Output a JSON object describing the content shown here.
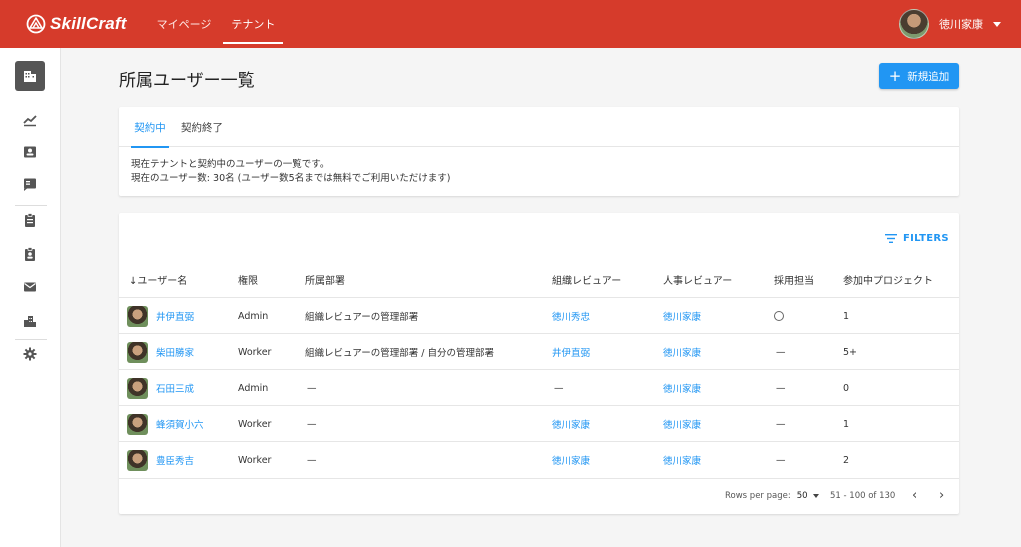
{
  "app": {
    "logo_text": "SkillCraft"
  },
  "nav": [
    {
      "label": "マイページ"
    },
    {
      "label": "テナント"
    }
  ],
  "user": {
    "name": "徳川家康"
  },
  "page": {
    "title": "所属ユーザー一覧",
    "add_button": "新規追加"
  },
  "tabs": [
    {
      "label": "契約中"
    },
    {
      "label": "契約終了"
    }
  ],
  "description": {
    "line1": "現在テナントと契約中のユーザーの一覧です。",
    "line2": "現在のユーザー数: 30名 (ユーザー数5名までは無料でご利用いただけます)"
  },
  "filters_label": "FILTERS",
  "columns": {
    "name": "ユーザー名",
    "role": "権限",
    "dept": "所属部署",
    "org_reviewer": "組織レビュアー",
    "hr_reviewer": "人事レビュアー",
    "recruiting": "採用担当",
    "projects": "参加中プロジェクト"
  },
  "rows": [
    {
      "name": "井伊直弼",
      "role": "Admin",
      "dept": "組織レビュアーの管理部署",
      "org_reviewer": "徳川秀忠",
      "hr_reviewer": "徳川家康",
      "recruiting": "",
      "projects": "1"
    },
    {
      "name": "柴田勝家",
      "role": "Worker",
      "dept": "組織レビュアーの管理部署 / 自分の管理部署",
      "org_reviewer": "井伊直弼",
      "hr_reviewer": "徳川家康",
      "recruiting": "—",
      "projects": "5+"
    },
    {
      "name": "石田三成",
      "role": "Admin",
      "dept": "—",
      "org_reviewer": "—",
      "hr_reviewer": "徳川家康",
      "recruiting": "—",
      "projects": "0"
    },
    {
      "name": "蜂須賀小六",
      "role": "Worker",
      "dept": "—",
      "org_reviewer": "徳川家康",
      "hr_reviewer": "徳川家康",
      "recruiting": "—",
      "projects": "1"
    },
    {
      "name": "豊臣秀吉",
      "role": "Worker",
      "dept": "—",
      "org_reviewer": "徳川家康",
      "hr_reviewer": "徳川家康",
      "recruiting": "—",
      "projects": "2"
    }
  ],
  "pagination": {
    "rows_per_page_label": "Rows per page:",
    "rows_per_page_value": "50",
    "range": "51 - 100 of 130"
  },
  "colors": {
    "header": "#d63b2b",
    "accent": "#2196f3"
  },
  "sidebar_icons": [
    "building-icon",
    "trending-up-icon",
    "contact-card-icon",
    "contact-mail-icon",
    "clipboard-icon",
    "clipboard-account-icon",
    "mail-icon",
    "city-icon",
    "gear-icon"
  ]
}
